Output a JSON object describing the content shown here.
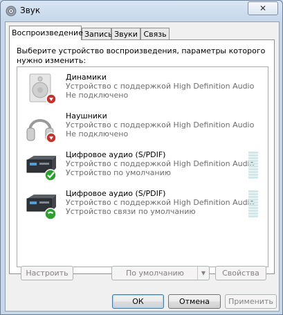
{
  "window": {
    "title": "Звук",
    "close_label": "✕"
  },
  "tabs": [
    {
      "label": "Воспроизведение",
      "active": true
    },
    {
      "label": "Запись",
      "active": false
    },
    {
      "label": "Звуки",
      "active": false
    },
    {
      "label": "Связь",
      "active": false
    }
  ],
  "panel": {
    "instruction": "Выберите устройство воспроизведения, параметры которого нужно изменить:"
  },
  "devices": [
    {
      "name": "Динамики",
      "description": "Устройство с поддержкой High Definition Audio",
      "status": "Не подключено",
      "icon": "speaker-icon",
      "badge": "disconnected-badge"
    },
    {
      "name": "Наушники",
      "description": "Устройство с поддержкой High Definition Audio",
      "status": "Не подключено",
      "icon": "headphones-icon",
      "badge": "disconnected-badge"
    },
    {
      "name": "Цифровое аудио (S/PDIF)",
      "description": "Устройство с поддержкой High Definition Audio",
      "status": "Устройство по умолчанию",
      "icon": "digital-audio-icon",
      "badge": "default-check-badge"
    },
    {
      "name": "Цифровое аудио (S/PDIF)",
      "description": "Устройство с поддержкой High Definition Audio",
      "status": "Устройство связи по умолчанию",
      "icon": "digital-audio-icon",
      "badge": "communication-phone-badge"
    }
  ],
  "panel_buttons": {
    "configure": "Настроить",
    "set_default": "По умолчанию",
    "properties": "Свойства"
  },
  "dialog_buttons": {
    "ok": "ОК",
    "cancel": "Отмена",
    "apply": "Применить"
  },
  "colors": {
    "window_frame": "#c6d7ea",
    "selected_tab": "#ffffff",
    "disabled_text": "#838383",
    "status_text": "#6d6d6d",
    "check_green": "#2ea02e",
    "disconnect_red": "#c8312c"
  }
}
